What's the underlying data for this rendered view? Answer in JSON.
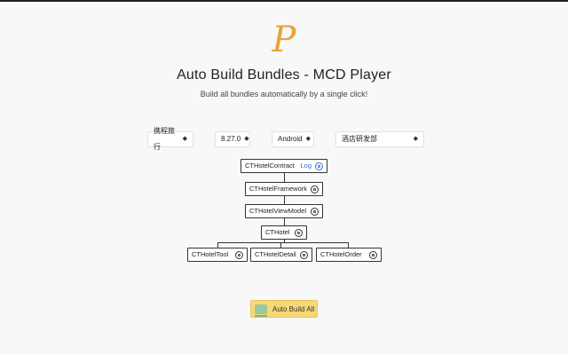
{
  "header": {
    "logo_glyph": "P",
    "title": "Auto Build Bundles - MCD Player",
    "subtitle": "Build all bundles automatically by a single click!"
  },
  "selectors": {
    "company": "携程旅行",
    "version": "8.27.0",
    "platform": "Android",
    "department": "酒店研发部",
    "caret": "◆"
  },
  "tree": {
    "root": {
      "label": "CTHotelContract",
      "log_label": "Log"
    },
    "framework": {
      "label": "CTHotelFramework"
    },
    "viewmodel": {
      "label": "CTHotelViewModel"
    },
    "hotel": {
      "label": "CTHotel"
    },
    "children": [
      {
        "label": "CTHotelTool"
      },
      {
        "label": "CTHotelDetail"
      },
      {
        "label": "CTHotelOrder"
      }
    ]
  },
  "actions": {
    "auto_build_label": "Auto Build All"
  },
  "colors": {
    "accent_logo": "#e8a23c",
    "button_bg": "#f7d876",
    "log_link": "#2a6fd6"
  }
}
